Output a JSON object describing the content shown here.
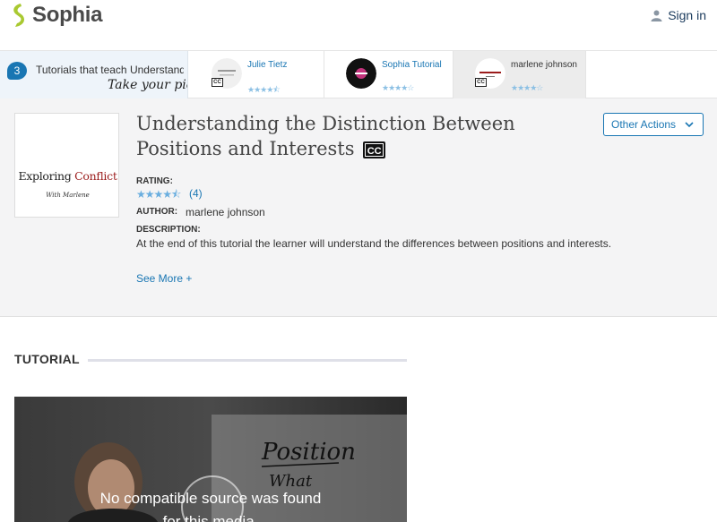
{
  "header": {
    "logo_text": "Sophia",
    "signin_label": "Sign in"
  },
  "strip": {
    "count": "3",
    "text": "Tutorials that teach Understanding the Distinction Between Positions and Interests",
    "pick": "Take your pick:",
    "cards": [
      {
        "name": "Julie Tietz",
        "rating": "★★★★⯪",
        "active": false
      },
      {
        "name": "Sophia Tutorial",
        "rating": "★★★★☆",
        "active": false
      },
      {
        "name": "marlene johnson",
        "rating": "★★★★☆",
        "active": true
      }
    ],
    "cc": "CC"
  },
  "tutorial": {
    "thumb_title_a": "Exploring ",
    "thumb_title_b": "Conflict",
    "thumb_sub": "With Marlene",
    "title": "Understanding the Distinction Between Positions and Interests",
    "cc_badge": "CC",
    "other_actions_label": "Other Actions",
    "rating_label": "RATING:",
    "rating_stars": "★★★★⯪",
    "rating_count": "(4)",
    "author_label": "AUTHOR:",
    "author": "marlene johnson",
    "description_label": "DESCRIPTION:",
    "description": "At the end of this tutorial the learner will understand the differences between positions and interests.",
    "see_more": "See More +"
  },
  "section": {
    "heading": "TUTORIAL"
  },
  "video": {
    "message_line1": "No compatible source was found",
    "message_line2": "for this media.",
    "whiteboard_1": "Position",
    "whiteboard_2": "What"
  },
  "colors": {
    "accent": "#1976b3",
    "logo_green": "#a9c931",
    "panel_bg": "#f4f4f5"
  }
}
